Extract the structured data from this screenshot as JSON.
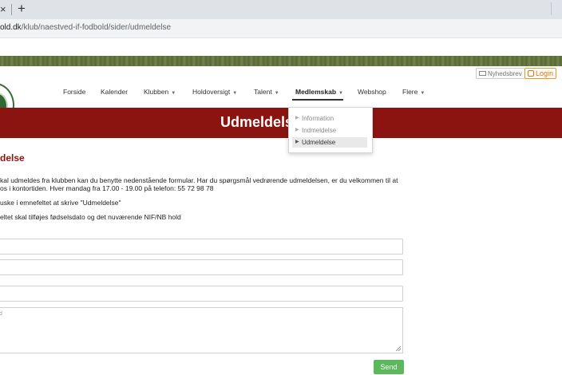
{
  "browser": {
    "close_glyph": "×",
    "new_tab_glyph": "+",
    "url_host": "old.dk",
    "url_path": "/klub/naestved-if-fodbold/sider/udmeldelse"
  },
  "utility": {
    "newsletter_label": "Nyhedsbrev",
    "login_label": "Login"
  },
  "nav": {
    "items": [
      {
        "label": "Forside",
        "caret": ""
      },
      {
        "label": "Kalender",
        "caret": ""
      },
      {
        "label": "Klubben",
        "caret": "▼"
      },
      {
        "label": "Holdoversigt",
        "caret": "▼"
      },
      {
        "label": "Talent",
        "caret": "▼"
      },
      {
        "label": "Medlemskab",
        "caret": "▼"
      },
      {
        "label": "Webshop",
        "caret": ""
      },
      {
        "label": "Flere",
        "caret": "▼"
      }
    ],
    "active_index": 5
  },
  "dropdown": {
    "items": [
      {
        "label": "Information",
        "selected": false
      },
      {
        "label": "Indmeldelse",
        "selected": false
      },
      {
        "label": "Udmeldelse",
        "selected": true
      }
    ]
  },
  "banner": {
    "title": "Udmeldels"
  },
  "content": {
    "heading": "delse",
    "para1_line1": "kal udmeldes fra klubben kan du benytte nedenstående formular. Har du spørgsmål vedrørende udmeldelsen, er du velkommen til at",
    "para1_line2": "os i kontortiden. Hver mandag fra 17.00 - 19.00 på telefon: 55 72 98 78",
    "para2": "uske i emnefeltet at skrive \"Udmeldelse\"",
    "para3": "eltet skal tilføjes fødselsdato og det nuværende NIF/NB hold"
  },
  "form": {
    "textarea_placeholder": "d",
    "send_label": "Send"
  },
  "colors": {
    "brand_red": "#8b1410",
    "send_green": "#5cb85c",
    "login_orange": "#e07b00"
  }
}
